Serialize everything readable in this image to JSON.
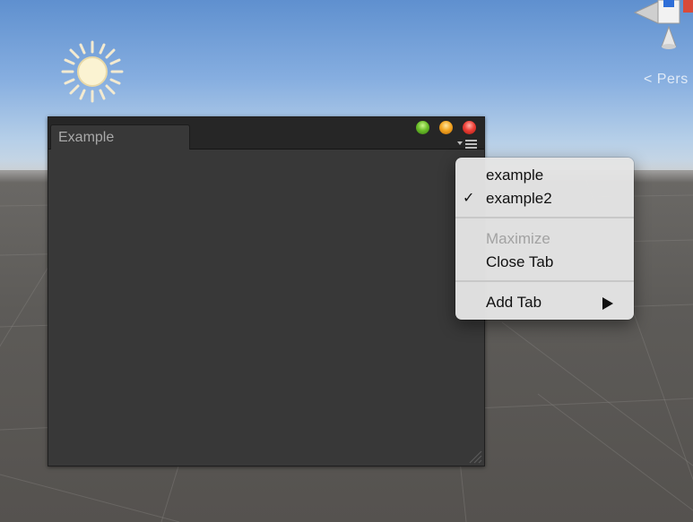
{
  "window": {
    "tab_label": "Example"
  },
  "scene": {
    "perspective_label": "< Pers"
  },
  "context_menu": {
    "items": [
      {
        "label": "example",
        "checked": false,
        "enabled": true
      },
      {
        "label": "example2",
        "checked": true,
        "enabled": true
      },
      {
        "label": "Maximize",
        "checked": false,
        "enabled": false
      },
      {
        "label": "Close Tab",
        "checked": false,
        "enabled": true
      },
      {
        "label": "Add Tab",
        "checked": false,
        "enabled": true,
        "submenu": true
      }
    ],
    "check_mark": "✓"
  },
  "icons": {
    "sun": "sun-icon",
    "gizmo": "scene-gizmo-icon",
    "window_menu": "menu-icon",
    "submenu": "submenu-arrow-icon",
    "resize": "resize-grip-icon"
  },
  "colors": {
    "window_bg": "#383838",
    "titlebar_bg": "#262626",
    "menu_bg": "#e4e4e4",
    "close": "#ee4037",
    "minimize": "#f5a623",
    "zoom": "#6cbf2a"
  }
}
